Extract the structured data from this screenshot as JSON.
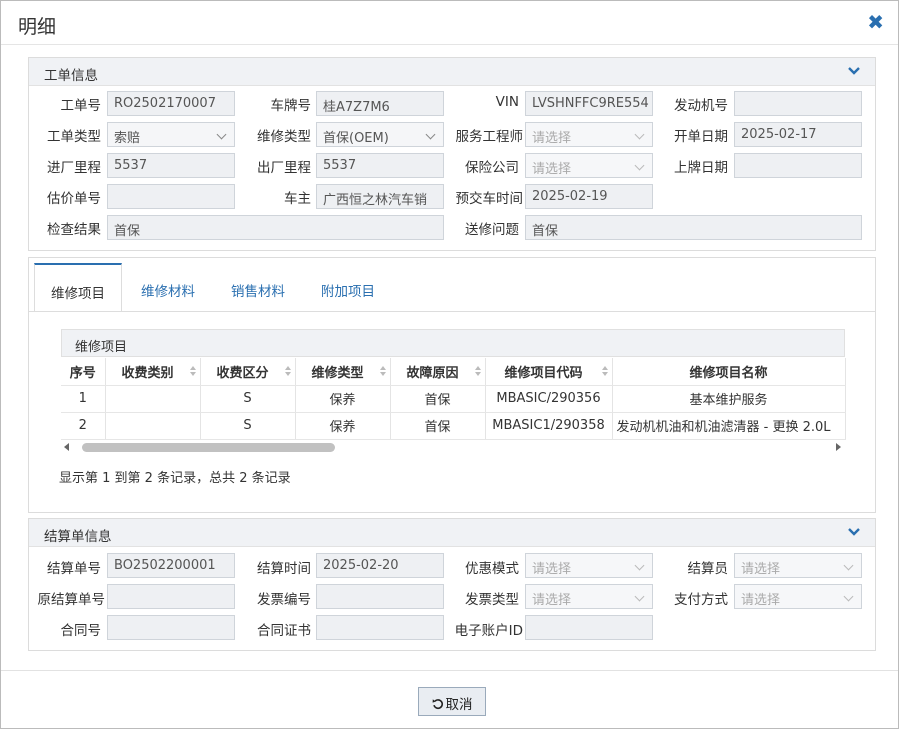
{
  "dialog": {
    "title": "明细",
    "close_icon": "close-icon"
  },
  "work_order": {
    "title": "工单信息",
    "fields": {
      "order_no": {
        "label": "工单号",
        "value": "RO2502170007"
      },
      "plate": {
        "label": "车牌号",
        "value": "桂A7Z7M6"
      },
      "vin": {
        "label": "VIN",
        "value": "LVSHNFFC9RE554"
      },
      "engine_no": {
        "label": "发动机号",
        "value": ""
      },
      "order_type": {
        "label": "工单类型",
        "value": "索赔"
      },
      "repair_type": {
        "label": "维修类型",
        "value": "首保(OEM)"
      },
      "service_engineer": {
        "label": "服务工程师",
        "placeholder": "请选择"
      },
      "open_date": {
        "label": "开单日期",
        "value": "2025-02-17"
      },
      "in_mileage": {
        "label": "进厂里程",
        "value": "5537"
      },
      "out_mileage": {
        "label": "出厂里程",
        "value": "5537"
      },
      "insurer": {
        "label": "保险公司",
        "placeholder": "请选择"
      },
      "plate_date": {
        "label": "上牌日期",
        "value": ""
      },
      "estimate_no": {
        "label": "估价单号",
        "value": ""
      },
      "owner": {
        "label": "车主",
        "value": "广西恒之林汽车销"
      },
      "delivery_time": {
        "label": "预交车时间",
        "value": "2025-02-19"
      },
      "inspection": {
        "label": "检查结果",
        "value": "首保"
      },
      "issue": {
        "label": "送修问题",
        "value": "首保"
      }
    }
  },
  "tabs": [
    "维修项目",
    "维修材料",
    "销售材料",
    "附加项目"
  ],
  "grid": {
    "caption": "维修项目",
    "columns": [
      "序号",
      "收费类别",
      "收费区分",
      "维修类型",
      "故障原因",
      "维修项目代码",
      "维修项目名称"
    ],
    "rows": [
      [
        "1",
        "",
        "S",
        "保养",
        "首保",
        "MBASIC/290356",
        "基本维护服务"
      ],
      [
        "2",
        "",
        "S",
        "保养",
        "首保",
        "MBASIC1/290358",
        "发动机机油和机油滤清器 - 更换 2.0L"
      ]
    ],
    "records_text": "显示第 1 到第 2 条记录，总共 2 条记录"
  },
  "settlement": {
    "title": "结算单信息",
    "fields": {
      "settle_no": {
        "label": "结算单号",
        "value": "BO2502200001"
      },
      "settle_time": {
        "label": "结算时间",
        "value": "2025-02-20"
      },
      "discount_mode": {
        "label": "优惠模式",
        "placeholder": "请选择"
      },
      "settler": {
        "label": "结算员",
        "placeholder": "请选择"
      },
      "orig_settle_no": {
        "label": "原结算单号",
        "value": ""
      },
      "invoice_no": {
        "label": "发票编号",
        "value": ""
      },
      "invoice_type": {
        "label": "发票类型",
        "placeholder": "请选择"
      },
      "pay_method": {
        "label": "支付方式",
        "placeholder": "请选择"
      },
      "contract_no": {
        "label": "合同号",
        "value": ""
      },
      "contract_cert": {
        "label": "合同证书",
        "value": ""
      },
      "e_account": {
        "label": "电子账户ID",
        "value": ""
      }
    }
  },
  "footer": {
    "cancel_label": "取消",
    "cancel_icon": "undo-icon"
  },
  "colors": {
    "accent": "#2a6fb0",
    "field_bg": "#eef0f3",
    "header_bg": "#f0f2f5"
  }
}
